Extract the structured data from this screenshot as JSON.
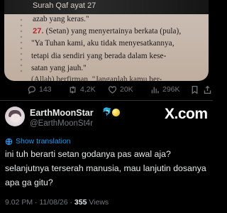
{
  "quoted_image": {
    "surah_header": "Surah Qaf ayat 27",
    "lines": [
      "azab yang keras.\"",
      "(Setan) yang menyertainya berkata (pula),",
      "\"Ya Tuhan kami, aku tidak menyesatkannya,",
      "tetapi dia sendiri yang berada dalam kese-",
      "satan yang jauh.\"",
      "(Allah) berfirman, \"Janganlah kamu ber-"
    ],
    "verse_number": "27."
  },
  "quoted_actions": {
    "replies": "143",
    "reposts": "4,2K",
    "likes": "20K",
    "views": "296K"
  },
  "reply": {
    "display_name": "EarthMoonStar",
    "name_emoji": "🐬",
    "handle": "@EarthMoonSt4r",
    "brand": "X.com",
    "translate_label": "Show translation",
    "text_lines": [
      "ini tuh berarti setan godanya pas awal aja?",
      "selanjutnya terserah manusia, mau lanjutin dosanya",
      "apa ga gitu?"
    ],
    "time": "9.02 PM",
    "date": "11/08/26",
    "separator": "·",
    "views_count": "355",
    "views_label": "Views"
  }
}
